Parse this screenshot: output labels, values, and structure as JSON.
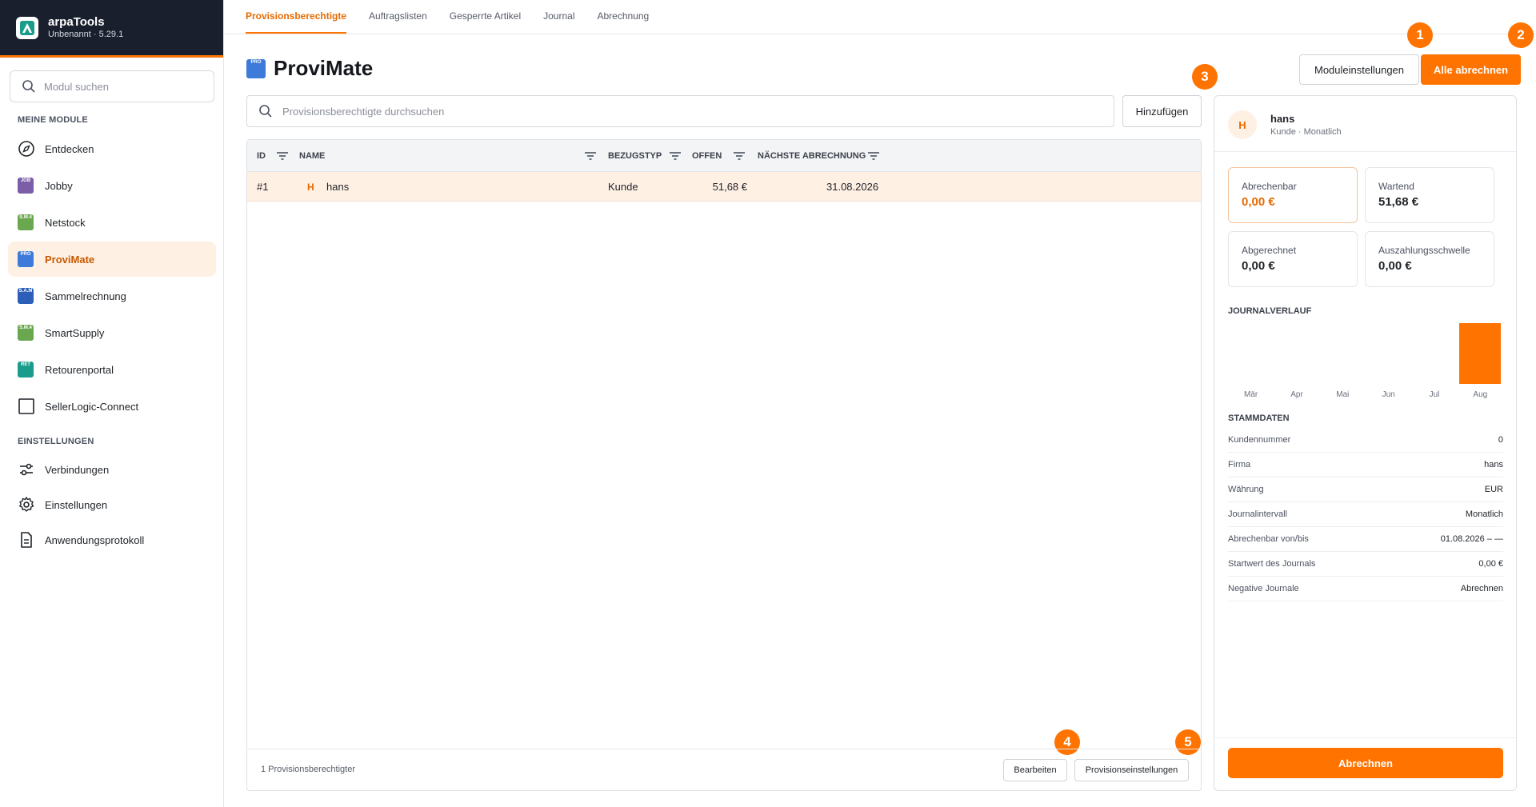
{
  "app": {
    "name": "arpaTools",
    "version": "Unbenannt · 5.29.1"
  },
  "sidebar": {
    "search_placeholder": "Modul suchen",
    "section_modules": "MEINE MODULE",
    "section_settings": "EINSTELLUNGEN",
    "modules": [
      {
        "label": "Entdecken",
        "icon": "compass-icon"
      },
      {
        "label": "Jobby",
        "icon": "jobby-module-icon",
        "badge": "JOB",
        "color": "#7b5ea7"
      },
      {
        "label": "Netstock",
        "icon": "netstock-module-icon",
        "badge": "S.M.4",
        "color": "#6aa84f"
      },
      {
        "label": "ProviMate",
        "icon": "provimate-module-icon",
        "badge": "PRO",
        "color": "#3d7ad9"
      },
      {
        "label": "Sammelrechnung",
        "icon": "sammelrechnung-module-icon",
        "badge": "S.A.M",
        "color": "#2e5fb8"
      },
      {
        "label": "SmartSupply",
        "icon": "smartsupply-module-icon",
        "badge": "S.M.4",
        "color": "#6aa84f"
      },
      {
        "label": "Retourenportal",
        "icon": "retourenportal-module-icon",
        "badge": "RET",
        "color": "#1a9c8c"
      },
      {
        "label": "SellerLogic-Connect",
        "icon": "sellerlogic-icon"
      }
    ],
    "settings": [
      {
        "label": "Verbindungen",
        "icon": "connections-icon"
      },
      {
        "label": "Einstellungen",
        "icon": "gear-icon"
      },
      {
        "label": "Anwendungsprotokoll",
        "icon": "document-icon"
      }
    ]
  },
  "tabs": [
    "Provisionsberechtigte",
    "Auftragslisten",
    "Gesperrte Artikel",
    "Journal",
    "Abrechnung"
  ],
  "page": {
    "title": "ProviMate",
    "module_badge": "PRO",
    "search_placeholder": "Provisionsberechtigte durchsuchen",
    "add_button": "Hinzufügen",
    "module_settings_button": "Moduleinstellungen",
    "bill_all_button": "Alle abrechnen",
    "callouts": [
      "1",
      "2",
      "3",
      "4",
      "5"
    ]
  },
  "table": {
    "columns": [
      "ID",
      "NAME",
      "BEZUGSTYP",
      "OFFEN",
      "NÄCHSTE ABRECHNUNG"
    ],
    "rows": [
      {
        "id": "#1",
        "initial": "H",
        "name": "hans",
        "type": "Kunde",
        "open": "51,68 €",
        "next": "31.08.2026"
      }
    ],
    "footer_count": "1 Provisionsberechtigter",
    "edit_button": "Bearbeiten",
    "commission_settings_button": "Provisionseinstellungen"
  },
  "detail": {
    "initial": "H",
    "name": "hans",
    "subtitle": "Kunde · Monatlich",
    "cards": [
      {
        "label": "Abrechenbar",
        "value": "0,00 €"
      },
      {
        "label": "Wartend",
        "value": "51,68 €"
      },
      {
        "label": "Abgerechnet",
        "value": "0,00 €"
      },
      {
        "label": "Auszahlungsschwelle",
        "value": "0,00 €"
      }
    ],
    "journal_title": "JOURNALVERLAUF",
    "master_title": "STAMMDATEN",
    "master": [
      {
        "k": "Kundennummer",
        "v": "0"
      },
      {
        "k": "Firma",
        "v": "hans"
      },
      {
        "k": "Währung",
        "v": "EUR"
      },
      {
        "k": "Journalintervall",
        "v": "Monatlich"
      },
      {
        "k": "Abrechenbar von/bis",
        "v": "01.08.2026 – —"
      },
      {
        "k": "Startwert des Journals",
        "v": "0,00 €"
      },
      {
        "k": "Negative Journale",
        "v": "Abrechnen"
      }
    ],
    "bill_button": "Abrechnen"
  },
  "chart_data": {
    "type": "bar",
    "categories": [
      "Mär",
      "Apr",
      "Mai",
      "Jun",
      "Jul",
      "Aug"
    ],
    "values": [
      0,
      0,
      0,
      0,
      0,
      51.68
    ],
    "title": "JOURNALVERLAUF",
    "xlabel": "",
    "ylabel": ""
  },
  "colors": {
    "accent": "#ff7300",
    "sidebar_header": "#1a1f2e",
    "row_highlight": "#fff0e4"
  }
}
